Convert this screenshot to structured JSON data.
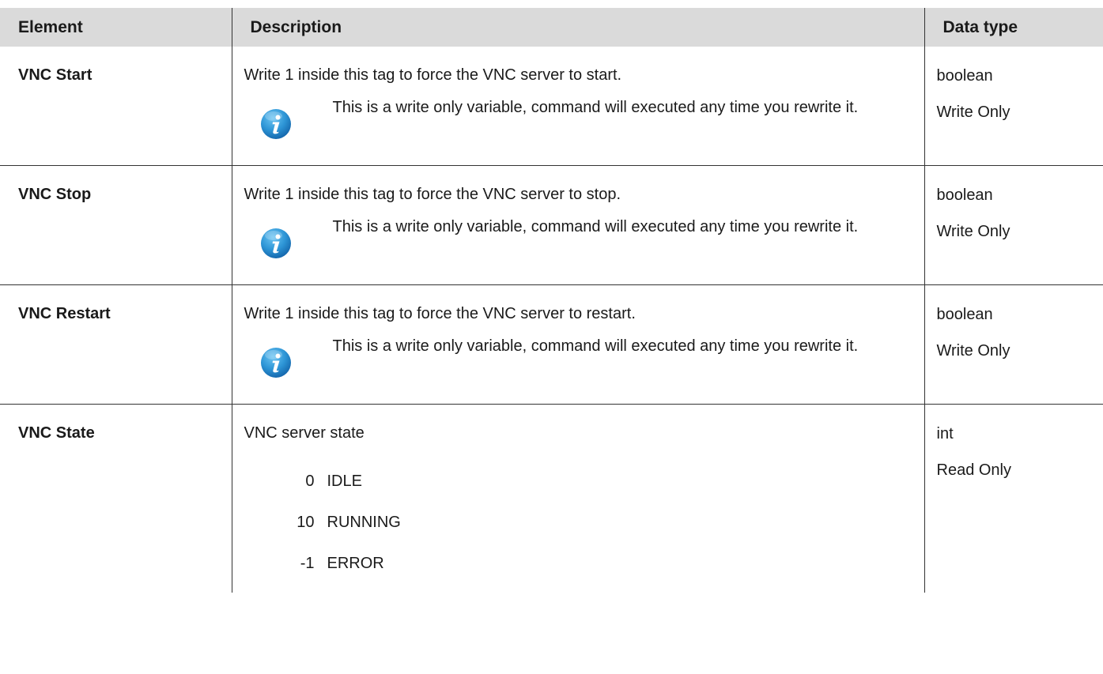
{
  "table": {
    "headers": {
      "element": "Element",
      "description": "Description",
      "data_type": "Data type"
    },
    "rows": [
      {
        "element": "VNC Start",
        "description": "Write 1 inside this tag to force the VNC server to start.",
        "note": "This is a write only variable, command will executed any time you rewrite it.",
        "type": "boolean",
        "access": "Write Only"
      },
      {
        "element": "VNC Stop",
        "description": "Write 1 inside this tag to force the VNC server to stop.",
        "note": "This is a write only variable, command will executed any time you rewrite it.",
        "type": "boolean",
        "access": "Write Only"
      },
      {
        "element": "VNC Restart",
        "description": "Write 1 inside this tag to force the VNC server to restart.",
        "note": "This is a write only variable, command will executed any time you rewrite it.",
        "type": "boolean",
        "access": "Write Only"
      },
      {
        "element": "VNC State",
        "description": "VNC server state",
        "states": [
          {
            "code": "0",
            "label": "IDLE"
          },
          {
            "code": "10",
            "label": "RUNNING"
          },
          {
            "code": "-1",
            "label": "ERROR"
          }
        ],
        "type": "int",
        "access": "Read Only"
      }
    ]
  },
  "icons": {
    "note_icon": "info-icon",
    "note_icon_color": "#1e88c8"
  }
}
